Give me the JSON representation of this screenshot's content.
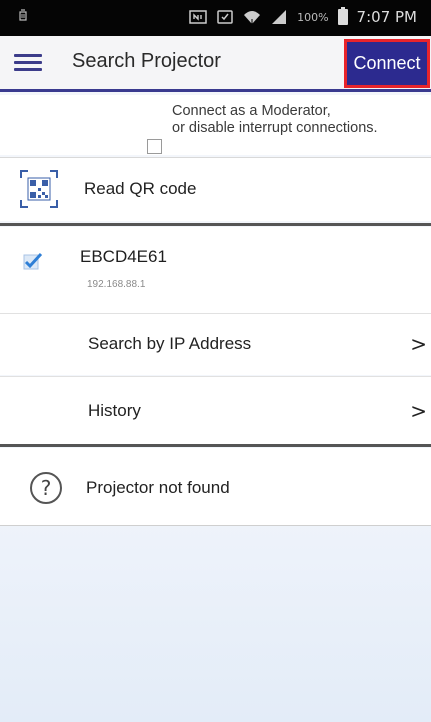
{
  "status_bar": {
    "left_icon": "notification-icon",
    "battery_percent": "100%",
    "time": "7:07 PM"
  },
  "app_bar": {
    "title": "Search Projector",
    "connect_label": "Connect",
    "connect_color": "#2c2a8f",
    "highlight_color": "#e8242b"
  },
  "moderator": {
    "line1": "Connect as a Moderator,",
    "line2": "or disable interrupt connections.",
    "checked": false
  },
  "qr": {
    "label": "Read QR code"
  },
  "projector": {
    "name": "EBCD4E61",
    "ip": "192.168.88.1",
    "selected": true
  },
  "options": [
    {
      "label": "Search by IP Address",
      "chevron": ">"
    },
    {
      "label": "History",
      "chevron": ">"
    }
  ],
  "not_found": {
    "label": "Projector not found"
  }
}
